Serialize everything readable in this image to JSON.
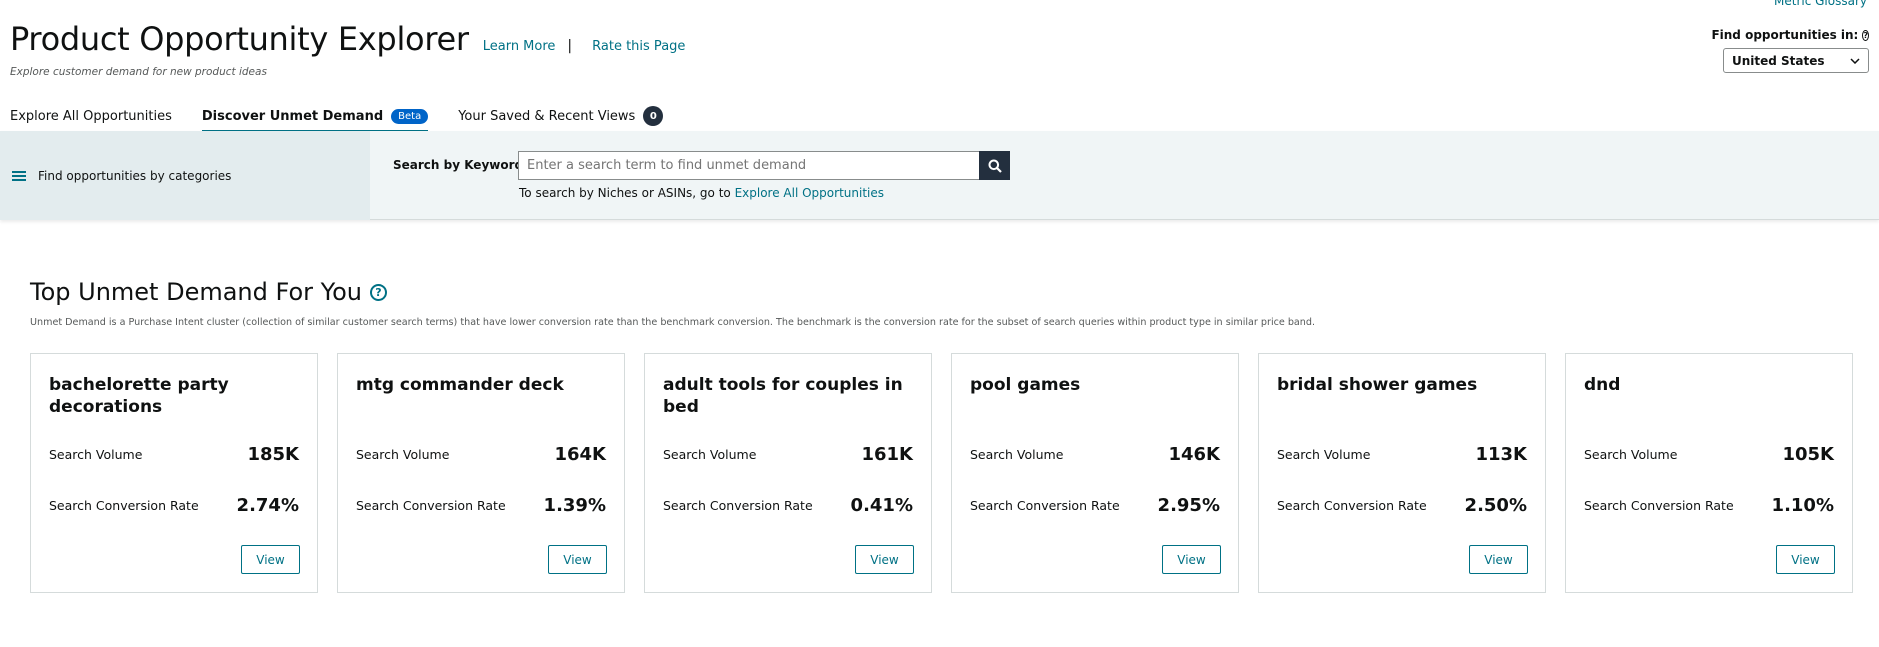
{
  "header": {
    "metric_glossary": "Metric Glossary",
    "title": "Product Opportunity Explorer",
    "learn_more": "Learn More",
    "separator": "|",
    "rate_page": "Rate this Page",
    "subtitle": "Explore customer demand for new product ideas"
  },
  "locale": {
    "label": "Find opportunities in:",
    "help_icon": "?",
    "selected": "United States"
  },
  "tabs": [
    {
      "label": "Explore All Opportunities",
      "active": false
    },
    {
      "label": "Discover Unmet Demand",
      "badge": "Beta",
      "active": true
    },
    {
      "label": "Your Saved & Recent Views",
      "count": "0",
      "active": false
    }
  ],
  "search": {
    "categories_label": "Find opportunities by categories",
    "keyword_label": "Search by Keyword",
    "placeholder": "Enter a search term to find unmet demand",
    "note_prefix": "To search by Niches or ASINs, go to ",
    "note_link": "Explore All Opportunities"
  },
  "section": {
    "title": "Top Unmet Demand For You",
    "help_icon": "?",
    "description": "Unmet Demand is a Purchase Intent cluster (collection of similar customer search terms) that have lower conversion rate than the benchmark conversion. The benchmark is the conversion rate for the subset of search queries within product type in similar price band."
  },
  "card_labels": {
    "volume": "Search Volume",
    "conversion": "Search Conversion Rate",
    "view": "View"
  },
  "cards": [
    {
      "title": "bachelorette party decorations",
      "volume": "185K",
      "conversion": "2.74%"
    },
    {
      "title": "mtg commander deck",
      "volume": "164K",
      "conversion": "1.39%"
    },
    {
      "title": "adult tools for couples in bed",
      "volume": "161K",
      "conversion": "0.41%"
    },
    {
      "title": "pool games",
      "volume": "146K",
      "conversion": "2.95%"
    },
    {
      "title": "bridal shower games",
      "volume": "113K",
      "conversion": "2.50%"
    },
    {
      "title": "dnd",
      "volume": "105K",
      "conversion": "1.10%"
    }
  ],
  "colors": {
    "link": "#007185",
    "beta_badge": "#0064c8",
    "dark_button": "#232f3e",
    "band_bg": "#f0f5f6"
  }
}
